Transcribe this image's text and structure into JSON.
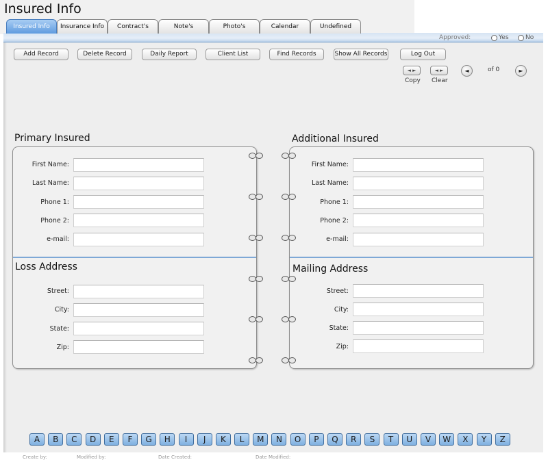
{
  "window": {
    "title": "Insured Info"
  },
  "tabs": [
    {
      "label": "Insured Info",
      "active": true
    },
    {
      "label": "Insurance Info",
      "active": false
    },
    {
      "label": "Contract's",
      "active": false
    },
    {
      "label": "Note's",
      "active": false
    },
    {
      "label": "Photo's",
      "active": false
    },
    {
      "label": "Calendar",
      "active": false
    },
    {
      "label": "Undefined",
      "active": false
    }
  ],
  "approval": {
    "label": "Approved:",
    "yes": "Yes",
    "no": "No"
  },
  "toolbar": {
    "add_record": "Add Record",
    "delete_record": "Delete Record",
    "daily_report": "Daily Report",
    "client_list": "Client List",
    "find_records": "Find Records",
    "show_all_records": "Show All Records",
    "log_out": "Log Out"
  },
  "record_nav": {
    "copy_label": "Copy",
    "clear_label": "Clear",
    "pair_glyph": "◄ ►",
    "prev_glyph": "◄",
    "next_glyph": "►",
    "count_text": "of 0"
  },
  "primary_insured": {
    "title": "Primary Insured",
    "fields": {
      "first_name": {
        "label": "First Name:",
        "value": ""
      },
      "last_name": {
        "label": "Last Name:",
        "value": ""
      },
      "phone1": {
        "label": "Phone 1:",
        "value": ""
      },
      "phone2": {
        "label": "Phone 2:",
        "value": ""
      },
      "email": {
        "label": "e-mail:",
        "value": ""
      }
    }
  },
  "additional_insured": {
    "title": "Additional Insured",
    "fields": {
      "first_name": {
        "label": "First Name:",
        "value": ""
      },
      "last_name": {
        "label": "Last Name:",
        "value": ""
      },
      "phone1": {
        "label": "Phone 1:",
        "value": ""
      },
      "phone2": {
        "label": "Phone 2:",
        "value": ""
      },
      "email": {
        "label": "e-mail:",
        "value": ""
      }
    }
  },
  "loss_address": {
    "title": "Loss Address",
    "fields": {
      "street": {
        "label": "Street:",
        "value": ""
      },
      "city": {
        "label": "City:",
        "value": ""
      },
      "state": {
        "label": "State:",
        "value": ""
      },
      "zip": {
        "label": "Zip:",
        "value": ""
      }
    }
  },
  "mailing_address": {
    "title": "Mailing Address",
    "fields": {
      "street": {
        "label": "Street:",
        "value": ""
      },
      "city": {
        "label": "City:",
        "value": ""
      },
      "state": {
        "label": "State:",
        "value": ""
      },
      "zip": {
        "label": "Zip:",
        "value": ""
      }
    }
  },
  "alphabet": [
    "A",
    "B",
    "C",
    "D",
    "E",
    "F",
    "G",
    "H",
    "I",
    "J",
    "K",
    "L",
    "M",
    "N",
    "O",
    "P",
    "Q",
    "R",
    "S",
    "T",
    "U",
    "V",
    "W",
    "X",
    "Y",
    "Z"
  ],
  "footer": {
    "created_by": "Create by:",
    "modified_by": "Modified by:",
    "date_created": "Date Created:",
    "date_modified": "Date Modified:"
  },
  "colors": {
    "active_tab": "#5f9be0",
    "header_bar": "#d6e4f3",
    "letter_button": "#7fb0e0",
    "panel_divider": "#7ea8d6"
  }
}
